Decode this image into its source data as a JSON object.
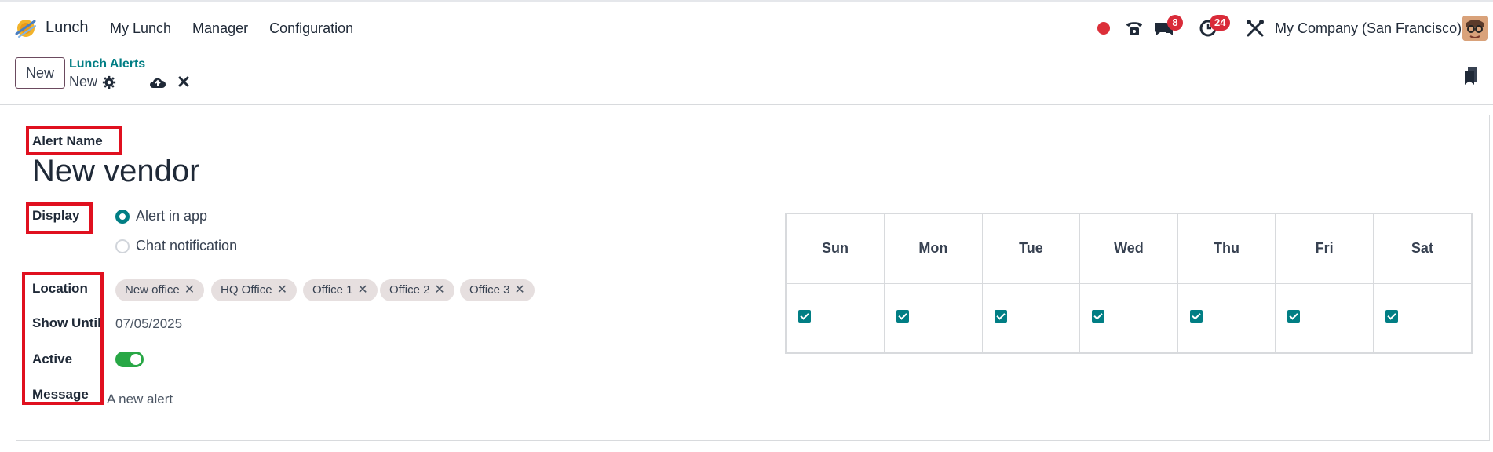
{
  "navbar": {
    "app_name": "Lunch",
    "menu": [
      "My Lunch",
      "Manager",
      "Configuration"
    ],
    "messages_badge": "8",
    "activities_badge": "24",
    "company": "My Company (San Francisco)"
  },
  "control": {
    "new_label": "New",
    "breadcrumb": "Lunch Alerts",
    "record_name": "New"
  },
  "form": {
    "alert_name_label": "Alert Name",
    "alert_name_value": "New vendor",
    "display_label": "Display",
    "display_options": [
      "Alert in app",
      "Chat notification"
    ],
    "display_selected": "Alert in app",
    "location_label": "Location",
    "locations": [
      "New office",
      "HQ Office",
      "Office 1",
      "Office 2",
      "Office 3"
    ],
    "show_until_label": "Show Until",
    "show_until_value": "07/05/2025",
    "active_label": "Active",
    "active_value": true,
    "message_label": "Message",
    "message_value": "A new alert"
  },
  "weekdays": {
    "headers": [
      "Sun",
      "Mon",
      "Tue",
      "Wed",
      "Thu",
      "Fri",
      "Sat"
    ],
    "checked": [
      true,
      true,
      true,
      true,
      true,
      true,
      true
    ]
  },
  "colors": {
    "accent": "#017e84",
    "highlight": "#e0101f",
    "badge": "#d92b39",
    "toggle_on": "#28a745"
  }
}
